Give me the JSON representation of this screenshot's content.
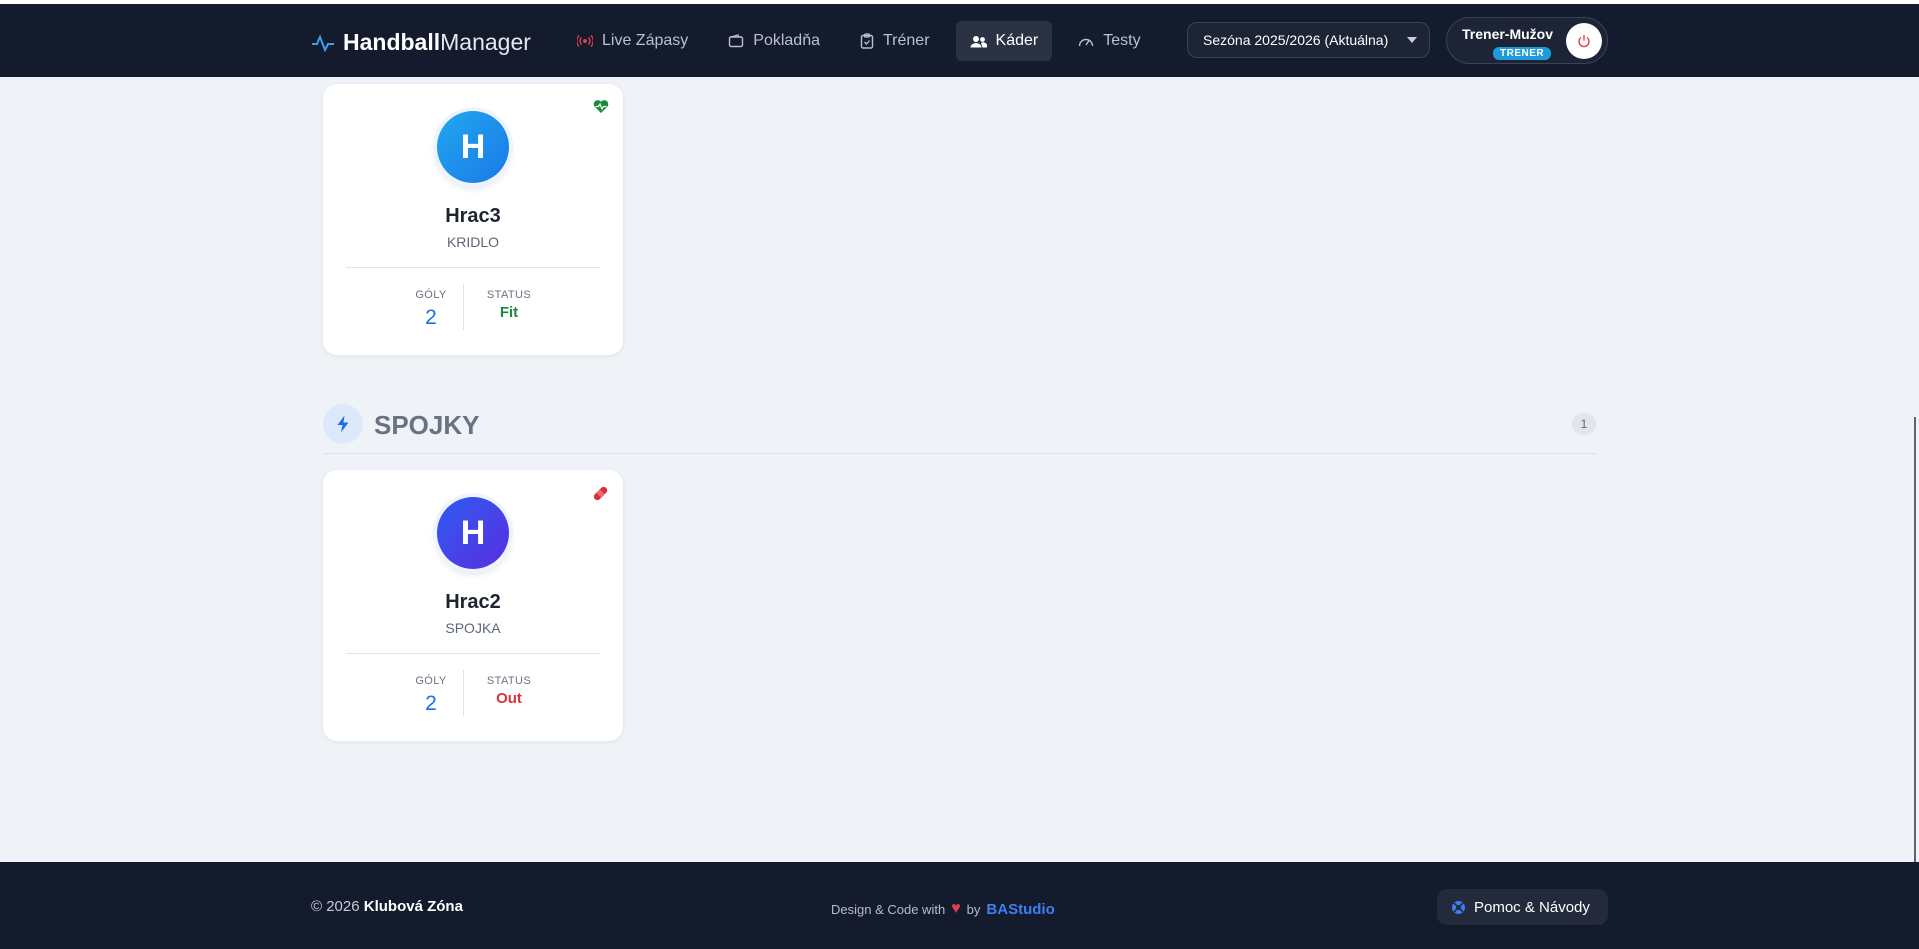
{
  "app": {
    "brand_bold": "Handball",
    "brand_light": "Manager"
  },
  "nav": {
    "items": [
      {
        "label": "Live Zápasy",
        "icon": "broadcast-icon"
      },
      {
        "label": "Pokladňa",
        "icon": "wallet-icon"
      },
      {
        "label": "Tréner",
        "icon": "clipboard-icon"
      },
      {
        "label": "Káder",
        "icon": "users-icon",
        "active": true
      },
      {
        "label": "Testy",
        "icon": "speedometer-icon"
      }
    ]
  },
  "season": {
    "selected": "Sezóna 2025/2026 (Aktuálna)"
  },
  "user": {
    "name": "Trener-Mužov",
    "role": "TRENER"
  },
  "stats_labels": {
    "goals": "GÓLY",
    "status": "STATUS"
  },
  "players": [
    {
      "initial": "H",
      "name": "Hrac3",
      "position": "KRIDLO",
      "goals": "2",
      "status": "Fit",
      "status_icon": "heart-pulse-icon"
    },
    {
      "initial": "H",
      "name": "Hrac2",
      "position": "SPOJKA",
      "goals": "2",
      "status": "Out",
      "status_icon": "bandage-icon"
    }
  ],
  "section": {
    "title": "SPOJKY",
    "count": "1",
    "icon": "lightning-icon"
  },
  "footer": {
    "copyright_prefix": "© 2026",
    "copyright_name": "Klubová Zóna",
    "credit_text": "Design & Code with",
    "credit_by": "by",
    "credit_studio": "BAStudio",
    "help_label": "Pomoc & Návody"
  },
  "colors": {
    "accent": "#1a6fe6",
    "fit": "#1b8a3e",
    "out": "#d8323c",
    "topbar": "#141b2c",
    "background": "#eff3f8"
  }
}
